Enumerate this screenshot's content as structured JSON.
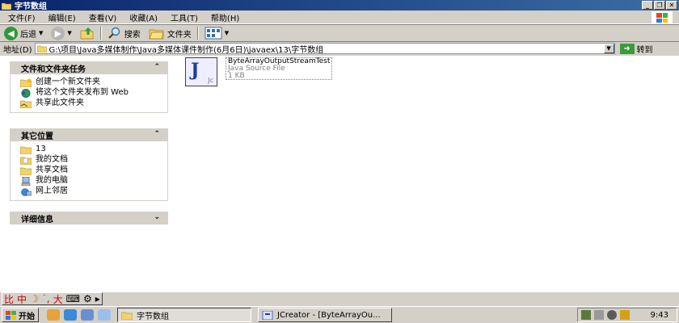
{
  "window": {
    "title": "字节数组"
  },
  "menu": [
    "文件(F)",
    "编辑(E)",
    "查看(V)",
    "收藏(A)",
    "工具(T)",
    "帮助(H)"
  ],
  "toolbar": {
    "back": "后退",
    "search": "搜索",
    "folders": "文件夹"
  },
  "address": {
    "label": "地址(D)",
    "path": "G:\\项目\\Java多媒体制作\\Java多媒体课件制作(6月6日)\\javaex\\13\\字节数组",
    "go": "转到"
  },
  "tasks_panel": {
    "title": "文件和文件夹任务",
    "items": [
      "创建一个新文件夹",
      "将这个文件夹发布到 Web",
      "共享此文件夹"
    ]
  },
  "places_panel": {
    "title": "其它位置",
    "items": [
      "13",
      "我的文档",
      "共享文档",
      "我的电脑",
      "网上邻居"
    ]
  },
  "details_panel": {
    "title": "详细信息"
  },
  "file": {
    "name": "ByteArrayOutputStreamTest",
    "type": "Java Source File",
    "size": "1 KB"
  },
  "ime": [
    "中",
    "大"
  ],
  "taskbar": {
    "start": "开始",
    "tasks": [
      "字节数组",
      "JCreator - [ByteArrayOu..."
    ],
    "clock": "9:43"
  }
}
